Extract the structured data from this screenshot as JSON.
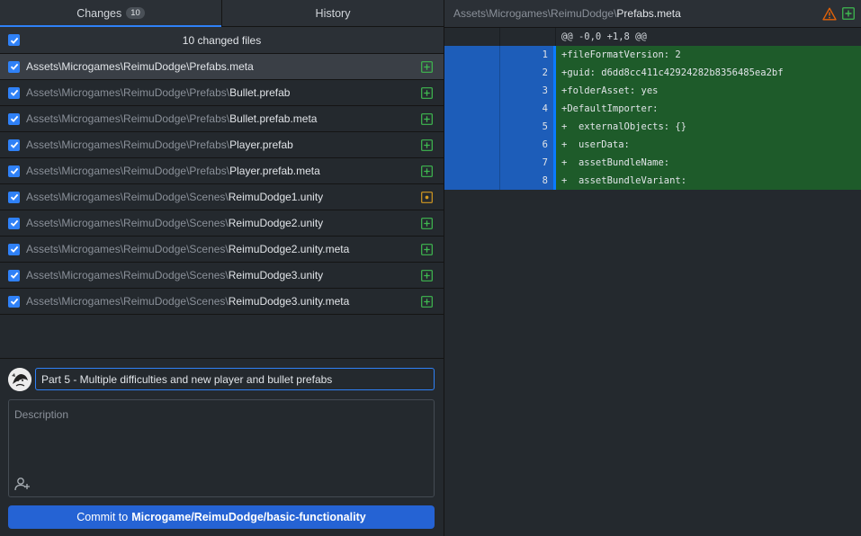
{
  "tabs": {
    "changes_label": "Changes",
    "changes_count": "10",
    "history_label": "History"
  },
  "changed_files_header": "10 changed files",
  "files": [
    {
      "dir": "Assets\\Microgames\\ReimuDodge\\",
      "name": "Prefabs.meta",
      "status": "added"
    },
    {
      "dir": "Assets\\Microgames\\ReimuDodge\\Prefabs\\",
      "name": "Bullet.prefab",
      "status": "added"
    },
    {
      "dir": "Assets\\Microgames\\ReimuDodge\\Prefabs\\",
      "name": "Bullet.prefab.meta",
      "status": "added"
    },
    {
      "dir": "Assets\\Microgames\\ReimuDodge\\Prefabs\\",
      "name": "Player.prefab",
      "status": "added"
    },
    {
      "dir": "Assets\\Microgames\\ReimuDodge\\Prefabs\\",
      "name": "Player.prefab.meta",
      "status": "added"
    },
    {
      "dir": "Assets\\Microgames\\ReimuDodge\\Scenes\\",
      "name": "ReimuDodge1.unity",
      "status": "modified"
    },
    {
      "dir": "Assets\\Microgames\\ReimuDodge\\Scenes\\",
      "name": "ReimuDodge2.unity",
      "status": "added"
    },
    {
      "dir": "Assets\\Microgames\\ReimuDodge\\Scenes\\",
      "name": "ReimuDodge2.unity.meta",
      "status": "added"
    },
    {
      "dir": "Assets\\Microgames\\ReimuDodge\\Scenes\\",
      "name": "ReimuDodge3.unity",
      "status": "added"
    },
    {
      "dir": "Assets\\Microgames\\ReimuDodge\\Scenes\\",
      "name": "ReimuDodge3.unity.meta",
      "status": "added"
    }
  ],
  "commit": {
    "summary_value": "Part 5 - Multiple difficulties and new player and bullet prefabs",
    "description_placeholder": "Description",
    "button_prefix": "Commit to ",
    "branch": "Microgame/ReimuDodge/basic-functionality"
  },
  "diff": {
    "path_dir": "Assets\\Microgames\\ReimuDodge\\",
    "path_name": "Prefabs.meta",
    "hunk_header": "@@ -0,0 +1,8 @@",
    "lines": [
      {
        "num": "1",
        "text": "+fileFormatVersion: 2"
      },
      {
        "num": "2",
        "text": "+guid: d6dd8cc411c42924282b8356485ea2bf"
      },
      {
        "num": "3",
        "text": "+folderAsset: yes"
      },
      {
        "num": "4",
        "text": "+DefaultImporter:"
      },
      {
        "num": "5",
        "text": "+  externalObjects: {}"
      },
      {
        "num": "6",
        "text": "+  userData:"
      },
      {
        "num": "7",
        "text": "+  assetBundleName:"
      },
      {
        "num": "8",
        "text": "+  assetBundleVariant:"
      }
    ]
  },
  "colors": {
    "accent": "#2f81f7",
    "added": "#3fb950",
    "modified": "#d29922",
    "warning": "#e36209",
    "diff_add_bg": "#1e5b2a",
    "diff_gutter_bg": "#1d5db9"
  },
  "icons": {
    "added": "plus-square-icon",
    "modified": "dot-square-icon",
    "warning": "warning-triangle-icon",
    "coauthor": "person-add-icon"
  }
}
